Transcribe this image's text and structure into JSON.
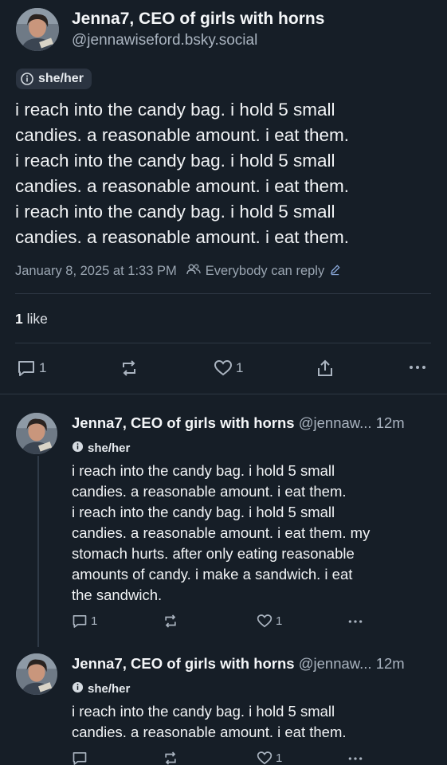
{
  "main_post": {
    "author_name": "Jenna7, CEO of girls with horns",
    "author_handle": "@jennawiseford.bsky.social",
    "pronouns": "she/her",
    "text_lines": [
      "i reach into the candy bag. i hold 5 small",
      "candies. a reasonable amount. i eat them.",
      "i reach into the candy bag. i hold 5 small",
      "candies. a reasonable amount. i eat them.",
      "i reach into the candy bag. i hold 5 small",
      "candies. a reasonable amount. i eat them."
    ],
    "timestamp": "January 8, 2025 at 1:33 PM",
    "reply_setting": "Everybody can reply",
    "like_count_number": "1",
    "like_count_label": "like",
    "actions": {
      "reply_count": "1",
      "like_count": "1"
    }
  },
  "replies": [
    {
      "author_name": "Jenna7, CEO of girls with horns",
      "author_handle": "@jennaw...",
      "age": "12m",
      "pronouns": "she/her",
      "text_lines": [
        "i reach into the candy bag. i hold 5 small",
        "candies. a reasonable amount. i eat them.",
        "i reach into the candy bag. i hold 5 small",
        "candies. a reasonable amount. i eat them. my",
        "stomach hurts. after only eating reasonable",
        "amounts of candy. i make a sandwich. i eat",
        "the sandwich."
      ],
      "actions": {
        "reply_count": "1",
        "like_count": "1"
      }
    },
    {
      "author_name": "Jenna7, CEO of girls with horns",
      "author_handle": "@jennaw...",
      "age": "12m",
      "pronouns": "she/her",
      "text_lines": [
        "i reach into the candy bag. i hold 5 small",
        "candies. a reasonable amount. i eat them."
      ],
      "actions": {
        "reply_count": "",
        "like_count": "1"
      }
    }
  ],
  "icons": {
    "reply": "speech-bubble-icon",
    "repost": "repost-arrows-icon",
    "like": "heart-icon",
    "share": "share-upload-icon",
    "more": "more-dots-icon",
    "pronouns": "info-icon",
    "reply_setting": "people-icon",
    "edit": "pencil-icon"
  },
  "colors": {
    "background": "#161e27",
    "text": "#f1f3f5",
    "muted": "#9aa5b1",
    "divider": "#2d3743"
  }
}
